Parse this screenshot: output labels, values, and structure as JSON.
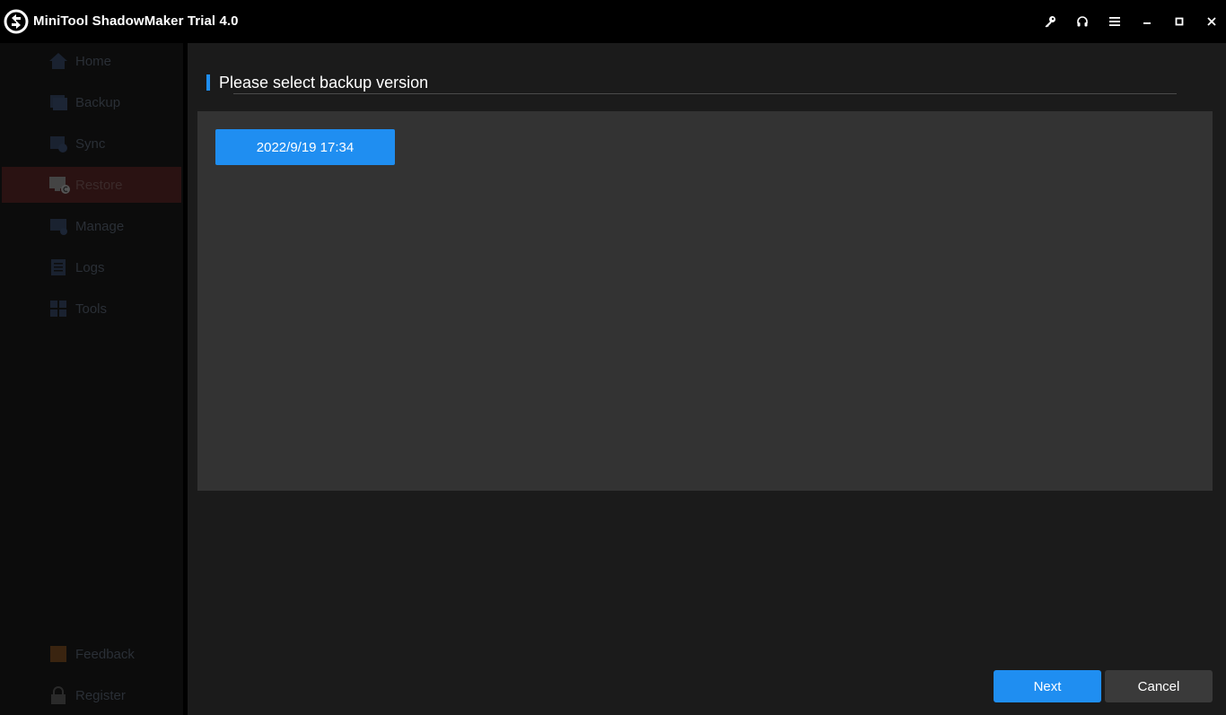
{
  "app": {
    "title": "MiniTool ShadowMaker Trial 4.0",
    "icons": {
      "logo": "minitool-logo-icon",
      "key": "key-icon",
      "support": "headset-icon",
      "menu": "hamburger-menu-icon",
      "minimize": "minimize-icon",
      "maximize": "maximize-icon",
      "close": "close-icon"
    }
  },
  "sidebar": {
    "items": [
      {
        "label": "Home",
        "icon": "home-icon"
      },
      {
        "label": "Backup",
        "icon": "backup-icon"
      },
      {
        "label": "Sync",
        "icon": "sync-icon"
      },
      {
        "label": "Restore",
        "icon": "restore-icon",
        "active": true
      },
      {
        "label": "Manage",
        "icon": "manage-icon"
      },
      {
        "label": "Logs",
        "icon": "logs-icon"
      },
      {
        "label": "Tools",
        "icon": "tools-icon"
      }
    ],
    "bottom_items": [
      {
        "label": "Feedback",
        "icon": "feedback-icon"
      },
      {
        "label": "Register",
        "icon": "lock-icon"
      }
    ]
  },
  "main": {
    "section_title": "Please select backup version",
    "versions": [
      "2022/9/19 17:34"
    ],
    "next_label": "Next",
    "cancel_label": "Cancel"
  },
  "colors": {
    "accent": "#1f8ef1",
    "panel": "#333333",
    "background": "#1b1b1b",
    "titlebar": "#000000"
  }
}
